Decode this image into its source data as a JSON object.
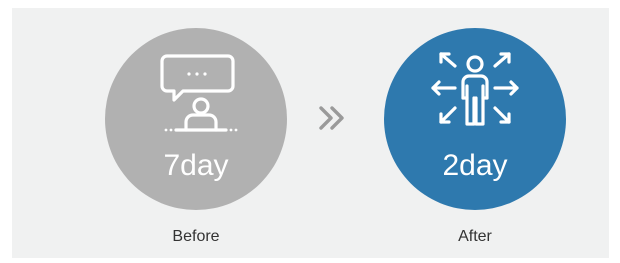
{
  "before": {
    "value": "7day",
    "caption": "Before",
    "icon": "presenter-speech-bubble-icon",
    "color": "#b1b1b1"
  },
  "transition": {
    "icon": "double-chevron-right-icon",
    "color": "#9a9a9a"
  },
  "after": {
    "value": "2day",
    "caption": "After",
    "icon": "person-arrows-outward-icon",
    "color": "#2e79ae"
  },
  "background": "#f0f1f1"
}
